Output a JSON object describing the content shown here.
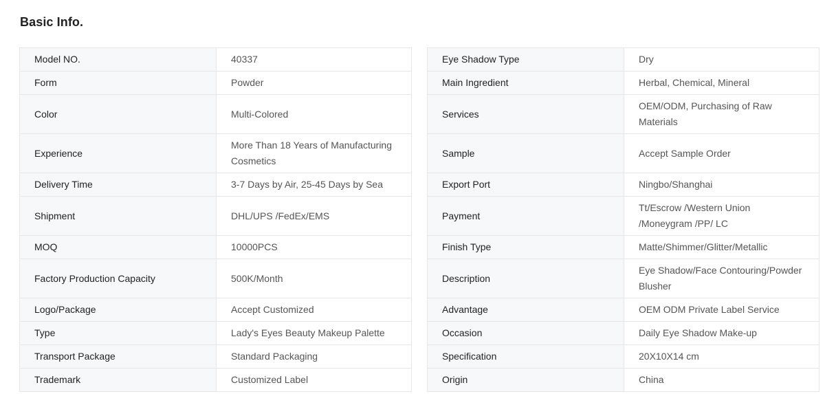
{
  "section_title": "Basic Info.",
  "left_table": [
    {
      "key": "Model NO.",
      "value": "40337",
      "tall": false
    },
    {
      "key": "Form",
      "value": "Powder",
      "tall": false
    },
    {
      "key": "Color",
      "value": "Multi-Colored",
      "tall": true
    },
    {
      "key": "Experience",
      "value": "More Than 18 Years of Manufacturing Cosmetics",
      "tall": true
    },
    {
      "key": "Delivery Time",
      "value": "3-7 Days by Air, 25-45 Days by Sea",
      "tall": false
    },
    {
      "key": "Shipment",
      "value": "DHL/UPS /FedEx/EMS",
      "tall": true
    },
    {
      "key": "MOQ",
      "value": "10000PCS",
      "tall": false
    },
    {
      "key": "Factory Production Capacity",
      "value": "500K/Month",
      "tall": true
    },
    {
      "key": "Logo/Package",
      "value": "Accept Customized",
      "tall": false
    },
    {
      "key": "Type",
      "value": "Lady's Eyes Beauty Makeup Palette",
      "tall": false
    },
    {
      "key": "Transport Package",
      "value": "Standard Packaging",
      "tall": false
    },
    {
      "key": "Trademark",
      "value": "Customized Label",
      "tall": false
    }
  ],
  "right_table": [
    {
      "key": "Eye Shadow Type",
      "value": "Dry",
      "tall": false
    },
    {
      "key": "Main Ingredient",
      "value": "Herbal, Chemical, Mineral",
      "tall": false
    },
    {
      "key": "Services",
      "value": "OEM/ODM, Purchasing of Raw Materials",
      "tall": true
    },
    {
      "key": "Sample",
      "value": "Accept Sample Order",
      "tall": true
    },
    {
      "key": "Export Port",
      "value": "Ningbo/Shanghai",
      "tall": false
    },
    {
      "key": "Payment",
      "value": "Tt/Escrow /Western Union /Moneygram /PP/ LC",
      "tall": true
    },
    {
      "key": "Finish Type",
      "value": "Matte/Shimmer/Glitter/Metallic",
      "tall": false
    },
    {
      "key": "Description",
      "value": "Eye Shadow/Face Contouring/Powder Blusher",
      "tall": true
    },
    {
      "key": "Advantage",
      "value": "OEM ODM Private Label Service",
      "tall": false
    },
    {
      "key": "Occasion",
      "value": "Daily Eye Shadow Make-up",
      "tall": false
    },
    {
      "key": "Specification",
      "value": "20X10X14 cm",
      "tall": false
    },
    {
      "key": "Origin",
      "value": "China",
      "tall": false
    }
  ]
}
